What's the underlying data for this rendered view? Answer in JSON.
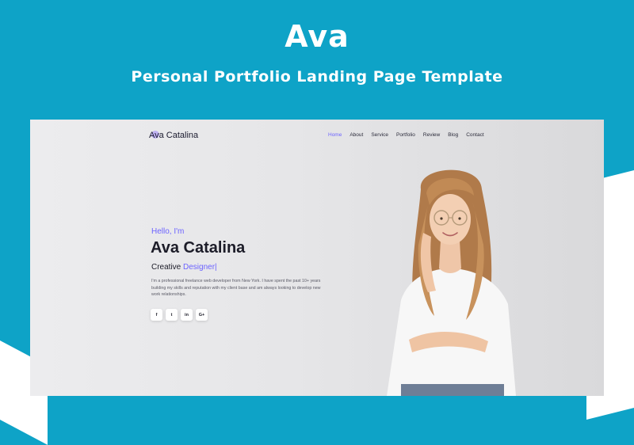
{
  "banner": {
    "title": "Ava",
    "subtitle": "Personal Portfolio Landing Page Template"
  },
  "preview": {
    "logo_text": "Ava Catalina",
    "nav": [
      "Home",
      "About",
      "Service",
      "Portfolio",
      "Review",
      "Blog",
      "Contact"
    ],
    "nav_active": "Home",
    "hero": {
      "greeting": "Hello, I'm",
      "name": "Ava Catalina",
      "role_prefix": "Creative ",
      "role_accent": "Designer",
      "role_cursor": "|",
      "description": "I'm a professional freelance web developer from New York. I have spent the past 10+ years building my skills and reputation with my client base and am always looking to develop new work relationships."
    },
    "social": [
      {
        "icon": "facebook-icon",
        "glyph": "f"
      },
      {
        "icon": "twitter-icon",
        "glyph": "t"
      },
      {
        "icon": "linkedin-icon",
        "glyph": "in"
      },
      {
        "icon": "google-plus-icon",
        "glyph": "G+"
      }
    ]
  },
  "colors": {
    "banner_bg": "#0ea3c7",
    "accent": "#6c63ff",
    "text_dark": "#1c1c28"
  }
}
